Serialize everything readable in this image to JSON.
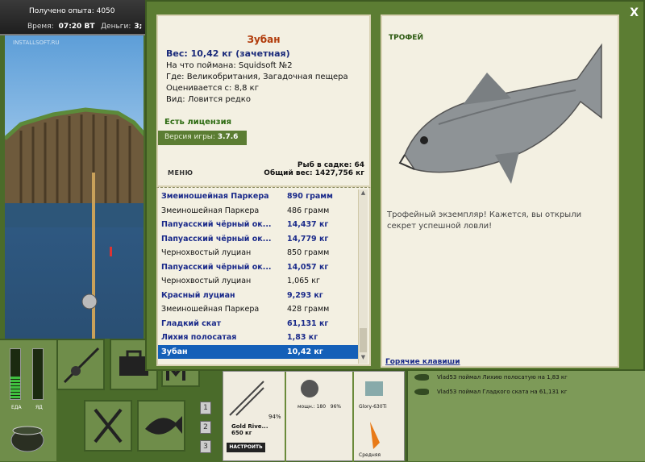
{
  "hud": {
    "experience": "Получено опыта: 4050",
    "time_label": "Время:",
    "time_value": "07:20 ВТ",
    "money_label": "Деньги:",
    "money_value": "3;",
    "watermark": "INSTALLSOFT.RU"
  },
  "meters": {
    "food_label": "ЕДА",
    "food_level": 0.45,
    "poison_label": "ЯД",
    "poison_level": 0
  },
  "slots": {
    "numbers": [
      "1",
      "2",
      "3"
    ]
  },
  "tackle": {
    "rod_name": "Gold Rive...",
    "rod_weight": "650 кг",
    "rod_percent": "94%",
    "reel_power": "мощн.: 180",
    "reel_percent": "96%",
    "line_name": "Glory-630Ti",
    "bait_level": "Средняя",
    "setup_button": "НАСТРОИТЬ"
  },
  "chat": {
    "messages": [
      "Vlad53 поймал Лихию полосатую на 1,83 кг",
      "Vlad53 поймал Гладкого ската на 61,131 кг"
    ]
  },
  "dialog": {
    "close": "X",
    "fish_name": "Зубан",
    "weight": "Вес: 10,42 кг (зачетная)",
    "caught_on": "На что поймана: Squidsoft №2",
    "location": "Где: Великобритания, Загадочная пещера",
    "estimated": "Оценивается с: 8,8 кг",
    "species": "Вид: Ловится редко",
    "license": "Есть лицензия",
    "version_label": "Версия игры:",
    "version_value": "3.7.6",
    "menu": "МЕНЮ",
    "fish_in_keepnet": "Рыб в садке: 64",
    "total_weight": "Общий вес: 1427,756 кг",
    "trophy_label": "ТРОФЕЙ",
    "trophy_text": "Трофейный экземпляр! Кажется, вы открыли секрет успешной ловли!",
    "hotkeys": "Горячие клавиши",
    "catch_list": [
      {
        "name": "Змеиношейная Паркера",
        "weight": "890 грамм",
        "style": "bold"
      },
      {
        "name": "Змеиношейная Паркера",
        "weight": "486 грамм",
        "style": "normal"
      },
      {
        "name": "Папуасский чёрный ок...",
        "weight": "14,437 кг",
        "style": "bold"
      },
      {
        "name": "Папуасский чёрный ок...",
        "weight": "14,779 кг",
        "style": "bold"
      },
      {
        "name": "Чернохвостый луциан",
        "weight": "850 грамм",
        "style": "normal"
      },
      {
        "name": "Папуасский чёрный ок...",
        "weight": "14,057 кг",
        "style": "bold"
      },
      {
        "name": "Чернохвостый луциан",
        "weight": "1,065 кг",
        "style": "normal"
      },
      {
        "name": "Красный луциан",
        "weight": "9,293 кг",
        "style": "bold"
      },
      {
        "name": "Змеиношейная Паркера",
        "weight": "428 грамм",
        "style": "normal"
      },
      {
        "name": "Гладкий скат",
        "weight": "61,131 кг",
        "style": "bold"
      },
      {
        "name": "Лихия полосатая",
        "weight": "1,83 кг",
        "style": "bold"
      },
      {
        "name": "Зубан",
        "weight": "10,42 кг",
        "style": "selected"
      }
    ]
  },
  "colors": {
    "frame_green": "#5c7d33",
    "panel_cream": "#f3f0e2",
    "selected_blue": "#1460b8",
    "title_red": "#b13b0a",
    "weight_navy": "#1a2a7a"
  }
}
